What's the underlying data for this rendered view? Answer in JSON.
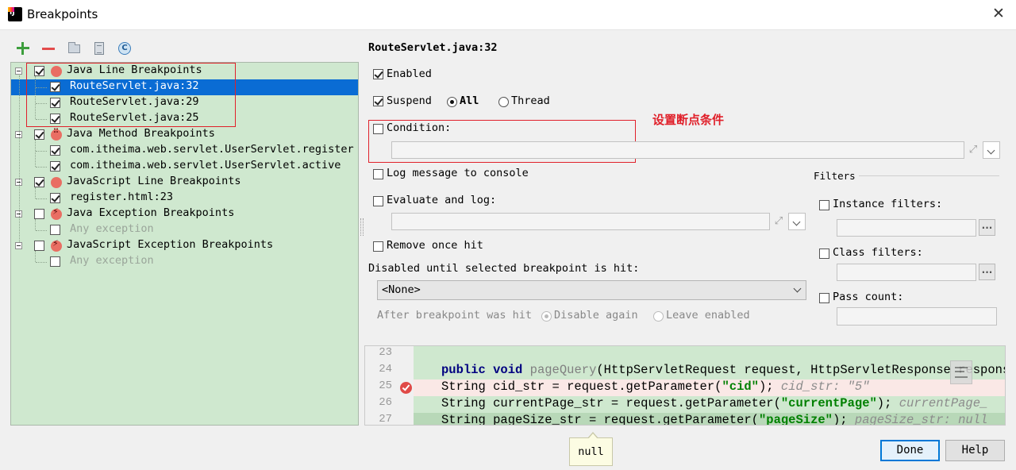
{
  "window": {
    "title": "Breakpoints"
  },
  "toolbar": {
    "add_icon": "plus-icon",
    "remove_icon": "minus-icon",
    "group_icon": "folder-icon",
    "file_icon": "file-icon",
    "class_icon": "class-icon",
    "class_letter": "C"
  },
  "tree": {
    "rows": [
      {
        "label": "Java Line Breakpoints",
        "checked": true,
        "kind": "group"
      },
      {
        "label": "RouteServlet.java:32",
        "checked": true,
        "kind": "item",
        "selected": true
      },
      {
        "label": "RouteServlet.java:29",
        "checked": true,
        "kind": "item"
      },
      {
        "label": "RouteServlet.java:25",
        "checked": true,
        "kind": "item"
      },
      {
        "label": "Java Method Breakpoints",
        "checked": true,
        "kind": "group"
      },
      {
        "label": "com.itheima.web.servlet.UserServlet.register",
        "checked": true,
        "kind": "item"
      },
      {
        "label": "com.itheima.web.servlet.UserServlet.active",
        "checked": true,
        "kind": "item"
      },
      {
        "label": "JavaScript Line Breakpoints",
        "checked": true,
        "kind": "group"
      },
      {
        "label": "register.html:23",
        "checked": true,
        "kind": "item"
      },
      {
        "label": "Java Exception Breakpoints",
        "checked": false,
        "kind": "group"
      },
      {
        "label": "Any exception",
        "checked": false,
        "kind": "item",
        "dim": true
      },
      {
        "label": "JavaScript Exception Breakpoints",
        "checked": false,
        "kind": "group"
      },
      {
        "label": "Any exception",
        "checked": false,
        "kind": "item",
        "dim": true
      }
    ]
  },
  "annotation": {
    "text": "设置断点条件",
    "color": "#e0202a"
  },
  "details": {
    "title": "RouteServlet.java:32",
    "enabled_label": "Enabled",
    "suspend_label": "Suspend",
    "all_label": "All",
    "thread_label": "Thread",
    "condition_label": "Condition:",
    "log_message_label": "Log message to console",
    "evaluate_label": "Evaluate and log:",
    "remove_once_label": "Remove once hit",
    "disabled_until_label": "Disabled until selected breakpoint is hit:",
    "none_option": "<None>",
    "after_hit_label": "After breakpoint was hit",
    "disable_again_label": "Disable again",
    "leave_enabled_label": "Leave enabled"
  },
  "filters": {
    "title": "Filters",
    "instance_label": "Instance filters:",
    "class_label": "Class filters:",
    "pass_count_label": "Pass count:",
    "browse_label": "..."
  },
  "code": {
    "lines": [
      {
        "num": "23"
      },
      {
        "num": "24"
      },
      {
        "num": "25"
      },
      {
        "num": "26"
      },
      {
        "num": "27"
      }
    ],
    "l24": {
      "kw1": "public",
      "kw2": "void",
      "fn": "pageQuery",
      "rest": "(HttpServletRequest request, HttpServletResponse response)"
    },
    "l25": {
      "code_a": "String cid_str = request.getParameter(",
      "str": "\"cid\"",
      "code_b": ");",
      "hint": "cid_str: \"5\""
    },
    "l26": {
      "code_a": "String currentPage_str = request.getParameter(",
      "str": "\"currentPage\"",
      "code_b": ");",
      "hint": "currentPage_"
    },
    "l27": {
      "code_a": "String pageSize_str = request.getParameter(",
      "str": "\"pageSize\"",
      "code_b": ");",
      "hint": "pageSize_str: null"
    },
    "tooltip": "null"
  },
  "buttons": {
    "done": "Done",
    "help": "Help"
  }
}
